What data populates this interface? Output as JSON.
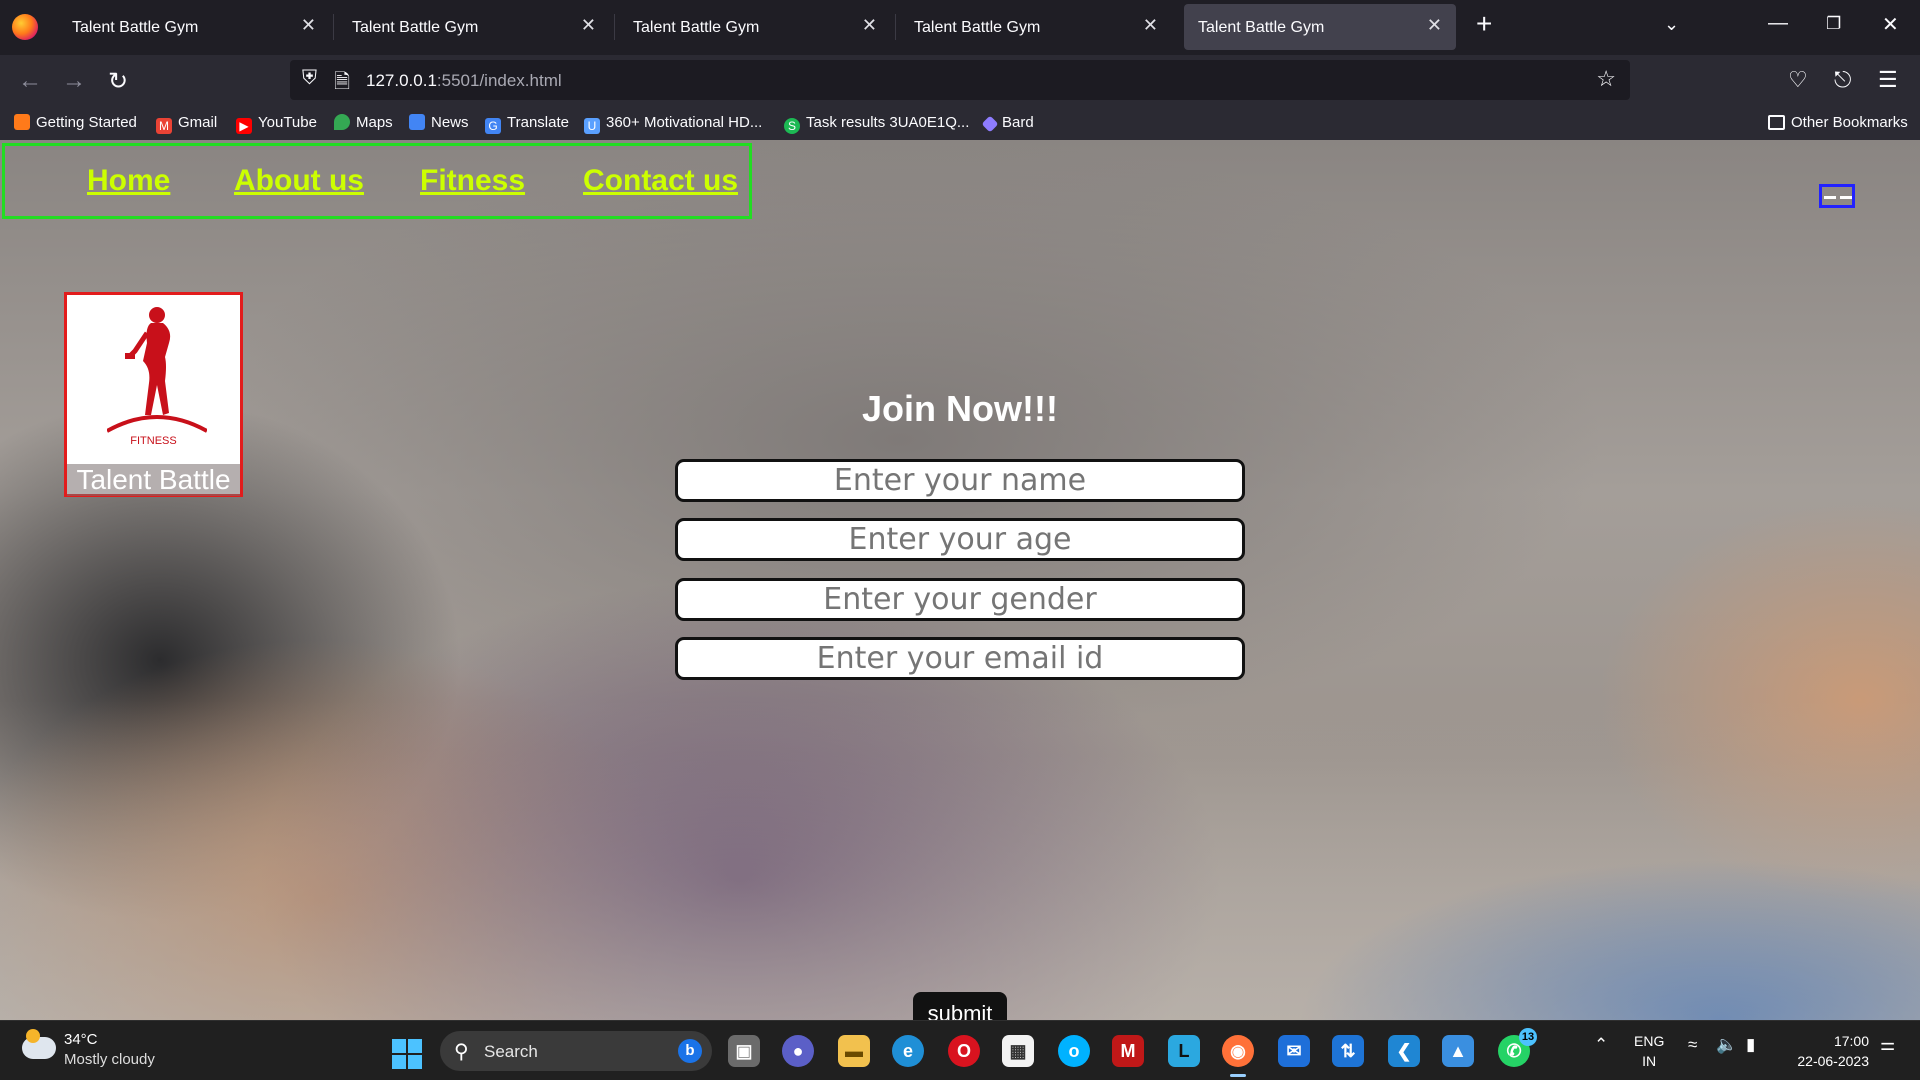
{
  "browser": {
    "tabs": [
      {
        "title": "Talent Battle Gym",
        "close": "✕"
      },
      {
        "title": "Talent Battle Gym",
        "close": "✕"
      },
      {
        "title": "Talent Battle Gym",
        "close": "✕"
      },
      {
        "title": "Talent Battle Gym",
        "close": "✕"
      },
      {
        "title": "Talent Battle Gym",
        "close": "✕"
      }
    ],
    "active_tab_index": 4,
    "new_tab": "+",
    "url_host": "127.0.0.1",
    "url_rest": ":5501/index.html",
    "bookmarks": [
      {
        "label": "Getting Started",
        "icon": "firefox-icon",
        "color": "#ff7a1a"
      },
      {
        "label": "Gmail",
        "icon": "gmail-icon",
        "color": "#ea4335"
      },
      {
        "label": "YouTube",
        "icon": "youtube-icon",
        "color": "#ff0000"
      },
      {
        "label": "Maps",
        "icon": "maps-icon",
        "color": "#34a853"
      },
      {
        "label": "News",
        "icon": "news-icon",
        "color": "#4285f4"
      },
      {
        "label": "Translate",
        "icon": "translate-icon",
        "color": "#4285f4"
      },
      {
        "label": "360+ Motivational HD...",
        "icon": "unsplash-icon",
        "color": "#5aa0ff"
      },
      {
        "label": "Task results 3UA0E1Q...",
        "icon": "s-icon",
        "color": "#1db954"
      },
      {
        "label": "Bard",
        "icon": "bard-icon",
        "color": "#8e7cff"
      }
    ],
    "other_bookmarks": "Other Bookmarks"
  },
  "site": {
    "nav": [
      "Home",
      "About us",
      "Fitness",
      "Contact us"
    ],
    "logo_small_text": "FITNESS",
    "brand": "Talent Battle",
    "form_title": "Join Now!!!",
    "fields": [
      {
        "placeholder": "Enter your name"
      },
      {
        "placeholder": "Enter your age"
      },
      {
        "placeholder": "Enter your gender"
      },
      {
        "placeholder": "Enter your email id"
      }
    ],
    "submit_label": "submit",
    "colors": {
      "nav_link": "#ccff00",
      "nav_border": "#22dd22",
      "logo_border": "#e21c1c",
      "toggle_border": "#2222ff"
    }
  },
  "taskbar": {
    "weather_temp": "34°C",
    "weather_desc": "Mostly cloudy",
    "search_label": "Search",
    "whatsapp_badge": "13",
    "lang_line1": "ENG",
    "lang_line2": "IN",
    "time": "17:00",
    "date": "22-06-2023"
  }
}
